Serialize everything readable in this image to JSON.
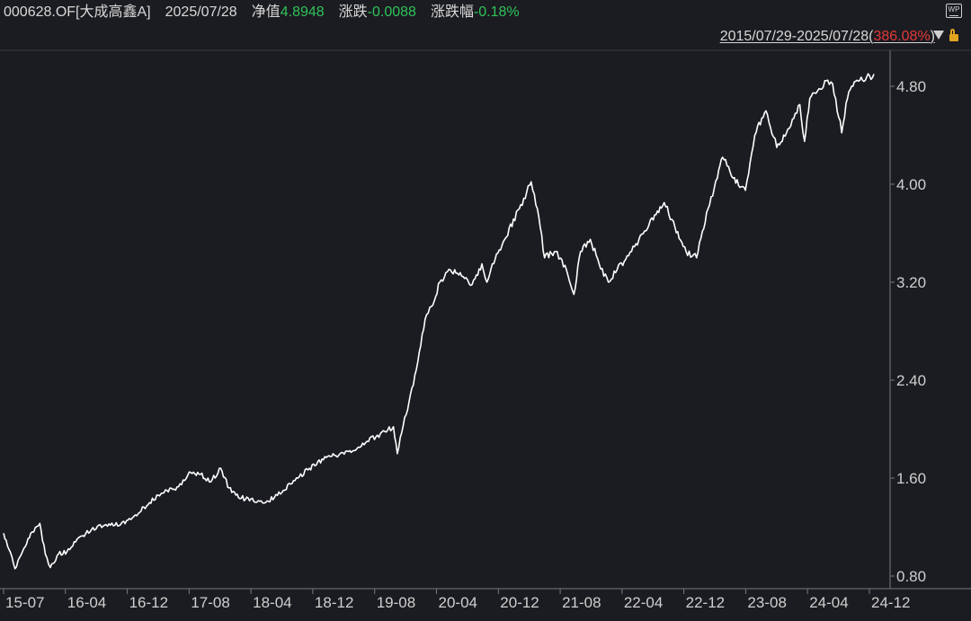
{
  "header": {
    "code_name": "000628.OF[大成高鑫A]",
    "date": "2025/07/28",
    "nav_label": "净值",
    "nav_value": "4.8948",
    "change_label": "涨跌",
    "change_value": "-0.0088",
    "pct_label": "涨跌幅",
    "pct_value": "-0.18%"
  },
  "range": {
    "period": "2015/07/29-2025/07/28",
    "return_pct": "386.08%"
  },
  "icons": {
    "corner": "wp-icon",
    "dropdown": "dropdown-triangle-icon",
    "lock": "lock-icon"
  },
  "colors": {
    "background": "#1b1c21",
    "line": "#ffffff",
    "down": "#2fc35a",
    "up": "#e33a3a",
    "text": "#d8d8d8"
  },
  "chart_data": {
    "type": "line",
    "title": "",
    "xlabel": "",
    "ylabel": "",
    "grid": false,
    "ylim": [
      0.72,
      5.15
    ],
    "yticks": [
      0.8,
      1.6,
      2.4,
      3.2,
      4.0,
      4.8
    ],
    "ytick_labels": [
      "0.80",
      "1.60",
      "2.40",
      "3.20",
      "4.00",
      "4.80"
    ],
    "xtick_labels": [
      "15-07",
      "16-04",
      "16-12",
      "17-08",
      "18-04",
      "18-12",
      "19-08",
      "20-04",
      "20-12",
      "21-08",
      "22-04",
      "22-12",
      "23-08",
      "24-04",
      "24-12"
    ],
    "x_range": [
      "2015-07-29",
      "2025-07-28"
    ],
    "series": [
      {
        "x": [
          "2015-07-29",
          "2015-08-20",
          "2015-09-15",
          "2015-10-10",
          "2015-11-20",
          "2015-12-28",
          "2016-01-20",
          "2016-02-10",
          "2016-03-15",
          "2016-04-20",
          "2016-06-01",
          "2016-08-01",
          "2016-10-01",
          "2016-12-01",
          "2017-02-01",
          "2017-04-01",
          "2017-06-01",
          "2017-08-01",
          "2017-09-15",
          "2017-11-01",
          "2017-12-15",
          "2018-01-25",
          "2018-03-01",
          "2018-04-10",
          "2018-06-01",
          "2018-08-01",
          "2018-10-15",
          "2018-12-15",
          "2019-02-01",
          "2019-04-01",
          "2019-06-10",
          "2019-08-01",
          "2019-10-01",
          "2019-12-15",
          "2020-01-20",
          "2020-02-05",
          "2020-03-01",
          "2020-03-25",
          "2020-05-01",
          "2020-06-01",
          "2020-07-10",
          "2020-08-01",
          "2020-09-15",
          "2020-11-01",
          "2020-12-15",
          "2021-01-25",
          "2021-02-15",
          "2021-03-10",
          "2021-05-01",
          "2021-07-01",
          "2021-08-20",
          "2021-09-15",
          "2021-10-15",
          "2021-12-01",
          "2022-01-15",
          "2022-02-15",
          "2022-03-15",
          "2022-04-25",
          "2022-06-01",
          "2022-07-10",
          "2022-08-15",
          "2022-10-15",
          "2022-11-15",
          "2022-12-15",
          "2023-01-20",
          "2023-03-01",
          "2023-04-15",
          "2023-06-01",
          "2023-07-15",
          "2023-09-01",
          "2023-10-10",
          "2023-11-01",
          "2023-12-15",
          "2024-02-05",
          "2024-03-15",
          "2024-05-01",
          "2024-06-15",
          "2024-08-01",
          "2024-09-20",
          "2024-10-10",
          "2024-11-01",
          "2024-12-10",
          "2025-01-15",
          "2025-02-05",
          "2025-03-15",
          "2025-04-08",
          "2025-05-01",
          "2025-06-10",
          "2025-07-28"
        ],
        "values": [
          1.15,
          1.02,
          0.86,
          0.97,
          1.15,
          1.23,
          0.98,
          0.87,
          0.98,
          1.0,
          1.1,
          1.18,
          1.22,
          1.22,
          1.3,
          1.4,
          1.48,
          1.53,
          1.65,
          1.63,
          1.57,
          1.68,
          1.52,
          1.44,
          1.43,
          1.4,
          1.5,
          1.6,
          1.68,
          1.75,
          1.8,
          1.82,
          1.9,
          1.98,
          2.02,
          1.8,
          2.03,
          2.22,
          2.55,
          2.9,
          3.05,
          3.2,
          3.3,
          3.25,
          3.18,
          3.35,
          3.2,
          3.35,
          3.55,
          3.8,
          4.02,
          3.8,
          3.4,
          3.45,
          3.3,
          3.1,
          3.45,
          3.55,
          3.35,
          3.2,
          3.3,
          3.45,
          3.55,
          3.62,
          3.75,
          3.85,
          3.65,
          3.45,
          3.4,
          3.8,
          4.05,
          4.22,
          4.05,
          3.95,
          4.4,
          4.6,
          4.3,
          4.45,
          4.65,
          4.35,
          4.7,
          4.78,
          4.85,
          4.82,
          4.42,
          4.7,
          4.8,
          4.85,
          4.9
        ]
      }
    ]
  }
}
